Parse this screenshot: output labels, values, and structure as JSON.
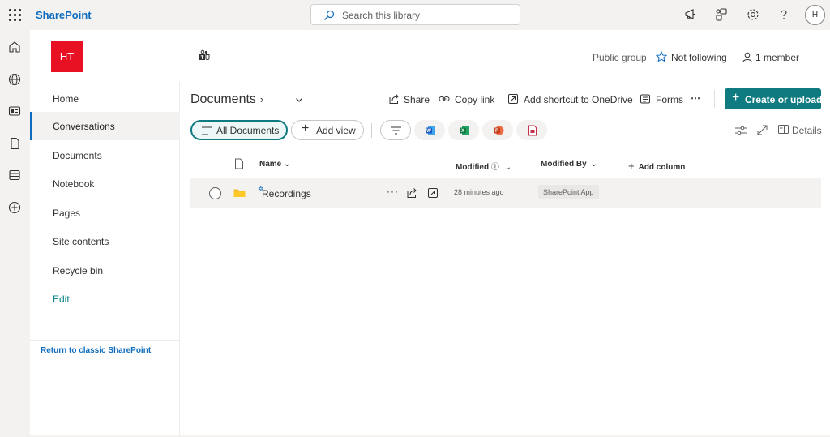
{
  "suite": {
    "brand": "SharePoint",
    "search_placeholder": "Search this library",
    "avatar_initial": "H"
  },
  "site": {
    "logo_initials": "HT",
    "group_type": "Public group",
    "follow_label": "Not following",
    "members_label": "1 member"
  },
  "nav": {
    "items": [
      {
        "label": "Home"
      },
      {
        "label": "Conversations"
      },
      {
        "label": "Documents"
      },
      {
        "label": "Notebook"
      },
      {
        "label": "Pages"
      },
      {
        "label": "Site contents"
      },
      {
        "label": "Recycle bin"
      },
      {
        "label": "Edit"
      }
    ],
    "classic_link": "Return to classic SharePoint"
  },
  "library": {
    "title": "Documents",
    "commands": {
      "share": "Share",
      "copy_link": "Copy link",
      "add_shortcut": "Add shortcut to OneDrive",
      "forms": "Forms",
      "more": "⋯",
      "create": "Create or upload"
    },
    "views": {
      "all_documents": "All Documents",
      "add_view": "Add view"
    },
    "details_label": "Details",
    "columns": {
      "name": "Name",
      "modified": "Modified",
      "modified_by": "Modified By",
      "add_column": "Add column"
    },
    "rows": [
      {
        "name": "Recordings",
        "modified": "28 minutes ago",
        "modified_by": "SharePoint App"
      }
    ]
  },
  "colors": {
    "accent": "#0f7b80",
    "brand_blue": "#0f6cbd",
    "site_logo": "#e81123"
  }
}
